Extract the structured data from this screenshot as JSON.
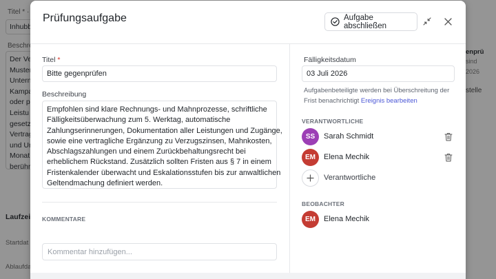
{
  "background": {
    "title_label": "Titel * ·",
    "title_value": "Inhubb",
    "description_label": "Beschre",
    "description_lines": [
      "Der Ve",
      "Muster",
      "Untern",
      "Kampa",
      "oder p",
      "Leistu",
      "gesetz",
      "Vertrag",
      "und Ur",
      "Monat",
      "berühr"
    ],
    "laufzeit_label": "Laufzeit",
    "start_label": "Startdat",
    "ablauf_label": "Ablaufda",
    "right_texts": [
      "enprü",
      "sind",
      "2026",
      "stelle"
    ]
  },
  "modal": {
    "title": "Prüfungsaufgabe",
    "complete_button": "Aufgabe abschließen",
    "collapse_icon": "collapse-arrows-icon",
    "close_icon": "close-icon",
    "title_field": {
      "label": "Titel",
      "required_mark": "*",
      "value": "Bitte gegenprüfen"
    },
    "description": {
      "label": "Beschreibung",
      "lines": [
        "Empfohlen sind klare Rechnungs- und Mahnprozesse, schriftliche",
        "Fälligkeitsüberwachung zum 5. Werktag, automatische",
        "Zahlungserinnerungen, Dokumentation aller Leistungen und Zugänge,",
        "sowie eine vertragliche Ergänzung zu Verzugszinsen, Mahnkosten,",
        "Abschlagszahlungen und einem Zurückbehaltungsrecht bei",
        "erheblichem Rückstand. Zusätzlich sollten Fristen aus § 7 in einem",
        "Fristenkalender überwacht und Eskalationsstufen bis zur anwaltlichen",
        "Geltendmachung definiert werden."
      ]
    },
    "comments": {
      "label": "KOMMENTARE",
      "placeholder": "Kommentar hinzufügen..."
    },
    "due_date": {
      "label": "Fälligkeitsdatum",
      "value": "03 Juli 2026",
      "note_part1": "Aufgabenbeteiligte werden bei Überschreitung der",
      "note_part2": "Frist benachrichtigt",
      "note_link": "Ereignis bearbeiten"
    },
    "responsible": {
      "label": "VERANTWORTLICHE",
      "people": [
        {
          "initials": "SS",
          "name": "Sarah Schmidt",
          "color": "#9c3fb5"
        },
        {
          "initials": "EM",
          "name": "Elena Mechik",
          "color": "#c43c33"
        }
      ],
      "add_label": "Verantwortliche"
    },
    "observers": {
      "label": "BEOBACHTER",
      "people": [
        {
          "initials": "EM",
          "name": "Elena Mechik",
          "color": "#c43c33"
        }
      ]
    }
  }
}
